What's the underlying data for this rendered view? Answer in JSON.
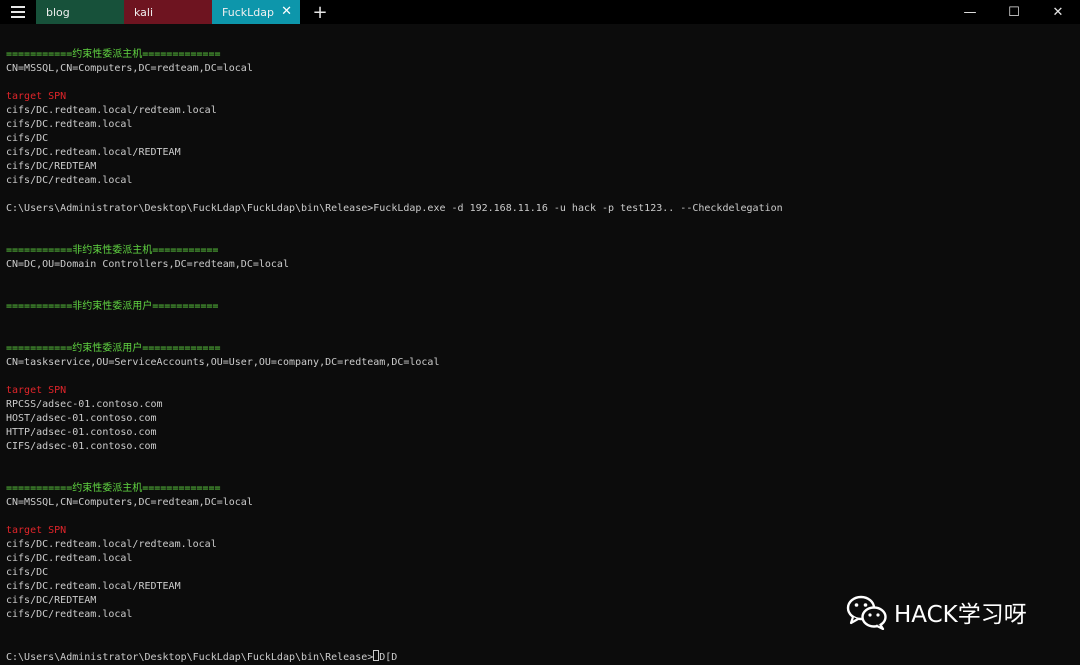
{
  "window": {
    "tabs": [
      {
        "label": "blog"
      },
      {
        "label": "kali"
      },
      {
        "label": "FuckLdap",
        "close": "✕"
      }
    ],
    "new_tab": "+",
    "controls": {
      "minimize": "—",
      "maximize": "☐",
      "close": "✕"
    }
  },
  "colors": {
    "green": "#61d642",
    "red": "#e0252a",
    "text": "#cccccc"
  },
  "terminal": {
    "lines": [
      {
        "text": "===========约束性委派主机=============",
        "color": "green"
      },
      {
        "text": "CN=MSSQL,CN=Computers,DC=redteam,DC=local",
        "color": "white"
      },
      {
        "text": "",
        "color": "white"
      },
      {
        "text": "target SPN",
        "color": "red"
      },
      {
        "text": "cifs/DC.redteam.local/redteam.local",
        "color": "white"
      },
      {
        "text": "cifs/DC.redteam.local",
        "color": "white"
      },
      {
        "text": "cifs/DC",
        "color": "white"
      },
      {
        "text": "cifs/DC.redteam.local/REDTEAM",
        "color": "white"
      },
      {
        "text": "cifs/DC/REDTEAM",
        "color": "white"
      },
      {
        "text": "cifs/DC/redteam.local",
        "color": "white"
      },
      {
        "text": "",
        "color": "white"
      },
      {
        "text": "C:\\Users\\Administrator\\Desktop\\FuckLdap\\FuckLdap\\bin\\Release>FuckLdap.exe -d 192.168.11.16 -u hack -p test123.. --Checkdelegation",
        "color": "white"
      },
      {
        "text": "",
        "color": "white"
      },
      {
        "text": "",
        "color": "white"
      },
      {
        "text": "===========非约束性委派主机===========",
        "color": "green"
      },
      {
        "text": "CN=DC,OU=Domain Controllers,DC=redteam,DC=local",
        "color": "white"
      },
      {
        "text": "",
        "color": "white"
      },
      {
        "text": "",
        "color": "white"
      },
      {
        "text": "===========非约束性委派用户===========",
        "color": "green"
      },
      {
        "text": "",
        "color": "white"
      },
      {
        "text": "",
        "color": "white"
      },
      {
        "text": "===========约束性委派用户=============",
        "color": "green"
      },
      {
        "text": "CN=taskservice,OU=ServiceAccounts,OU=User,OU=company,DC=redteam,DC=local",
        "color": "white"
      },
      {
        "text": "",
        "color": "white"
      },
      {
        "text": "target SPN",
        "color": "red"
      },
      {
        "text": "RPCSS/adsec-01.contoso.com",
        "color": "white"
      },
      {
        "text": "HOST/adsec-01.contoso.com",
        "color": "white"
      },
      {
        "text": "HTTP/adsec-01.contoso.com",
        "color": "white"
      },
      {
        "text": "CIFS/adsec-01.contoso.com",
        "color": "white"
      },
      {
        "text": "",
        "color": "white"
      },
      {
        "text": "",
        "color": "white"
      },
      {
        "text": "===========约束性委派主机=============",
        "color": "green"
      },
      {
        "text": "CN=MSSQL,CN=Computers,DC=redteam,DC=local",
        "color": "white"
      },
      {
        "text": "",
        "color": "white"
      },
      {
        "text": "target SPN",
        "color": "red"
      },
      {
        "text": "cifs/DC.redteam.local/redteam.local",
        "color": "white"
      },
      {
        "text": "cifs/DC.redteam.local",
        "color": "white"
      },
      {
        "text": "cifs/DC",
        "color": "white"
      },
      {
        "text": "cifs/DC.redteam.local/REDTEAM",
        "color": "white"
      },
      {
        "text": "cifs/DC/REDTEAM",
        "color": "white"
      },
      {
        "text": "cifs/DC/redteam.local",
        "color": "white"
      },
      {
        "text": "",
        "color": "white"
      },
      {
        "text": "",
        "color": "white"
      }
    ],
    "prompt": "C:\\Users\\Administrator\\Desktop\\FuckLdap\\FuckLdap\\bin\\Release>",
    "prompt_input": "D[D"
  },
  "watermark": {
    "text": "HACK学习呀",
    "icon": "wechat-icon"
  }
}
